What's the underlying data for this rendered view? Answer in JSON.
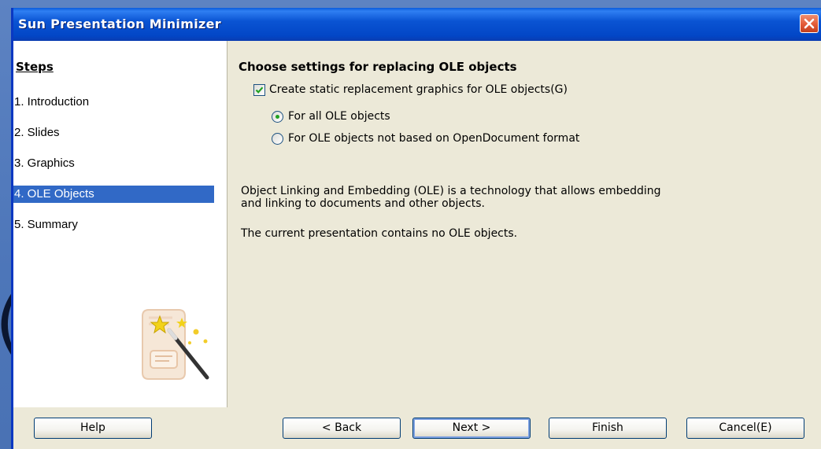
{
  "window": {
    "title": "Sun Presentation Minimizer"
  },
  "steps": {
    "title": "Steps",
    "items": [
      {
        "label": "1. Introduction",
        "active": false
      },
      {
        "label": "2. Slides",
        "active": false
      },
      {
        "label": "3. Graphics",
        "active": false
      },
      {
        "label": "4. OLE Objects",
        "active": true
      },
      {
        "label": "5. Summary",
        "active": false
      }
    ]
  },
  "main": {
    "heading": "Choose settings for replacing OLE objects",
    "create_static": {
      "label": "Create static replacement graphics for OLE objects(G)",
      "checked": true
    },
    "radio_all": {
      "label": "For all OLE objects",
      "selected": true
    },
    "radio_not_opendocument": {
      "label": "For OLE objects not based on OpenDocument format",
      "selected": false
    },
    "description_line1": "Object Linking and Embedding (OLE) is a technology that allows embedding",
    "description_line2": "and linking to documents and other objects.",
    "status": "The current presentation contains no OLE objects."
  },
  "footer": {
    "help": "Help",
    "back": "< Back",
    "next": "Next >",
    "finish": "Finish",
    "cancel": "Cancel(E)"
  },
  "colors": {
    "titlebar": "#0a54d3",
    "selection": "#3169c6",
    "dialog_bg": "#ece9d8",
    "close_button": "#e35a36"
  },
  "icons": {
    "close": "close-icon",
    "checkbox_check": "check-icon",
    "wizard": "wizard-wand-icon"
  }
}
